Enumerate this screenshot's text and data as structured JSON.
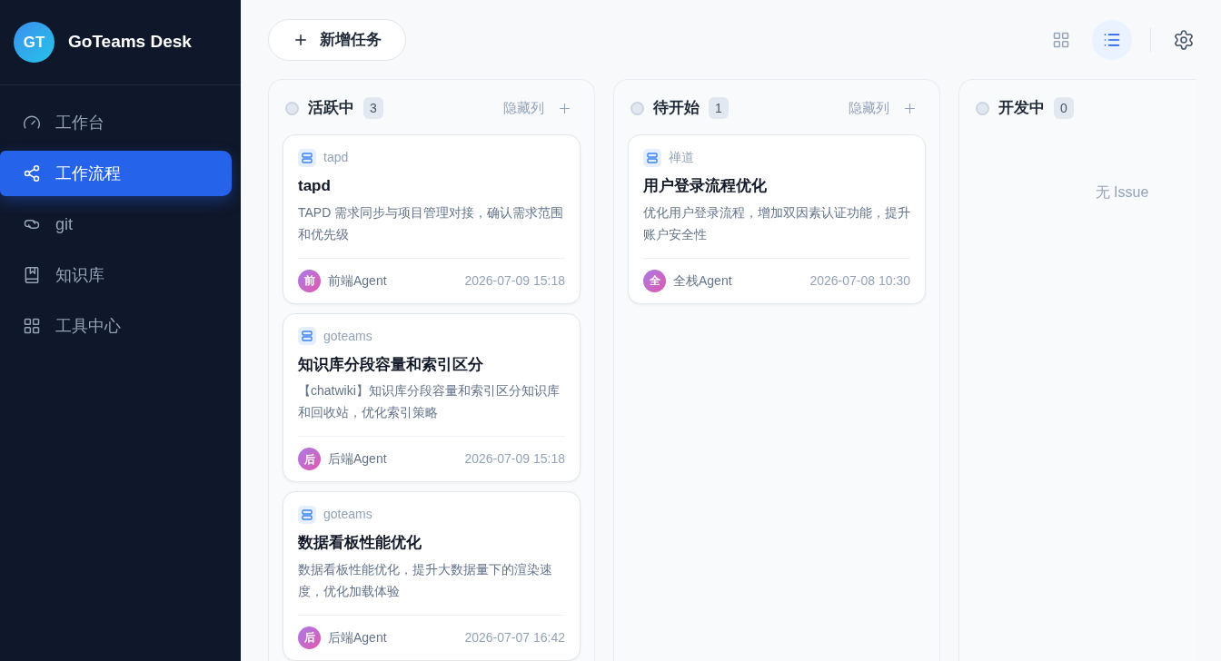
{
  "brand": {
    "initials": "GT",
    "name": "GoTeams Desk"
  },
  "sidebar": {
    "items": [
      {
        "kind": "dashboard",
        "label": "工作台",
        "selected": false
      },
      {
        "kind": "share",
        "label": "工作流程",
        "selected": true
      },
      {
        "kind": "git",
        "label": "git",
        "selected": false
      },
      {
        "kind": "book",
        "label": "知识库",
        "selected": false
      },
      {
        "kind": "grid",
        "label": "工具中心",
        "selected": false
      }
    ]
  },
  "toolbar": {
    "add_button": "新增任务",
    "view_toggles": [
      {
        "kind": "grid",
        "selected": false
      },
      {
        "kind": "list",
        "selected": true
      }
    ]
  },
  "columns": [
    {
      "title": "活跃中",
      "count": "3",
      "hide_label": "隐藏列",
      "cards": [
        {
          "source": "tapd",
          "title": "tapd",
          "description": "TAPD 需求同步与项目管理对接，确认需求范围和优先级",
          "avatar": "前",
          "agent": "前端Agent",
          "time": "2026-07-09 15:18"
        },
        {
          "source": "goteams",
          "title": "知识库分段容量和索引区分",
          "description": "【chatwiki】知识库分段容量和索引区分知识库和回收站，优化索引策略",
          "avatar": "后",
          "agent": "后端Agent",
          "time": "2026-07-09 15:18"
        },
        {
          "source": "goteams",
          "title": "数据看板性能优化",
          "description": "数据看板性能优化，提升大数据量下的渲染速度，优化加载体验",
          "avatar": "后",
          "agent": "后端Agent",
          "time": "2026-07-07 16:42"
        }
      ]
    },
    {
      "title": "待开始",
      "count": "1",
      "hide_label": "隐藏列",
      "cards": [
        {
          "source": "禅道",
          "title": "用户登录流程优化",
          "description": "优化用户登录流程，增加双因素认证功能，提升账户安全性",
          "avatar": "全",
          "agent": "全栈Agent",
          "time": "2026-07-08 10:30"
        }
      ]
    },
    {
      "title": "开发中",
      "count": "0",
      "empty_text": "无 Issue"
    }
  ]
}
